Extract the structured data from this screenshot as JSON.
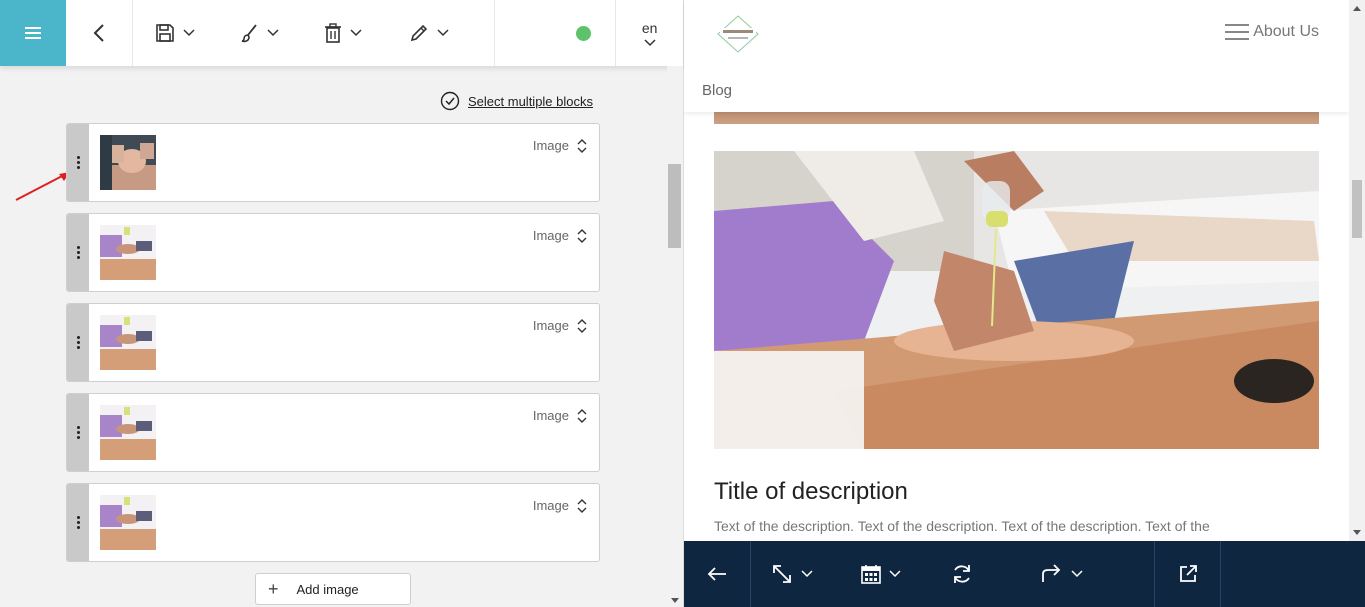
{
  "editor": {
    "select_multiple_label": "Select multiple blocks",
    "blocks": [
      {
        "type_label": "Image"
      },
      {
        "type_label": "Image"
      },
      {
        "type_label": "Image"
      },
      {
        "type_label": "Image"
      },
      {
        "type_label": "Image"
      }
    ],
    "add_button_label": "Add image",
    "language": "en",
    "status_color": "#5cc36b",
    "accent_color": "#4bb5c9"
  },
  "preview": {
    "nav_about": "About Us",
    "nav_blog": "Blog",
    "description_title": "Title of description",
    "description_text": "Text of the description. Text of the description. Text of the description. Text of the",
    "bottom_bar_color": "#0f2640"
  },
  "icons": {
    "menu": "hamburger-icon",
    "back": "chevron-left-icon",
    "save": "save-icon",
    "brush": "brush-icon",
    "trash": "trash-icon",
    "pencil": "pencil-icon",
    "check": "check-circle-icon",
    "drag": "drag-handle-icon",
    "sort": "sort-icon",
    "plus": "plus-icon",
    "arrow_back": "arrow-left-icon",
    "resize": "resize-icon",
    "calendar": "calendar-icon",
    "refresh": "refresh-icon",
    "share": "share-icon",
    "external": "external-link-icon"
  }
}
